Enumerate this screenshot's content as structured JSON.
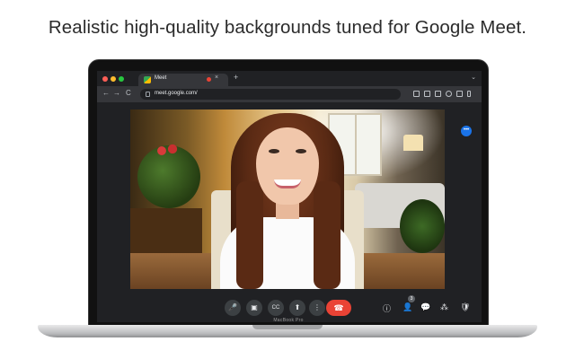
{
  "headline": "Realistic high-quality backgrounds tuned for Google Meet.",
  "laptop_label": "MacBook Pro",
  "browser": {
    "traffic_lights": [
      "#ff5f57",
      "#febc2e",
      "#28c840"
    ],
    "tab_title": "Meet",
    "tab_close": "×",
    "new_tab": "+",
    "tab_menu": "⌄",
    "url": "meet.google.com/",
    "back": "←",
    "forward": "→",
    "reload": "C"
  },
  "meet": {
    "more_options": "•••",
    "controls": {
      "mic": "🎤",
      "camera": "▣",
      "captions": "CC",
      "present": "⬆",
      "more": "⋮",
      "hangup": "☎"
    },
    "right_icons": {
      "info": "ⓘ",
      "people": "👤",
      "people_count": "3",
      "chat": "💬",
      "activities": "⁂",
      "host": "🛡"
    }
  },
  "colors": {
    "accent": "#1a73e8",
    "hangup": "#ea4335",
    "screen_bg": "#202124"
  }
}
